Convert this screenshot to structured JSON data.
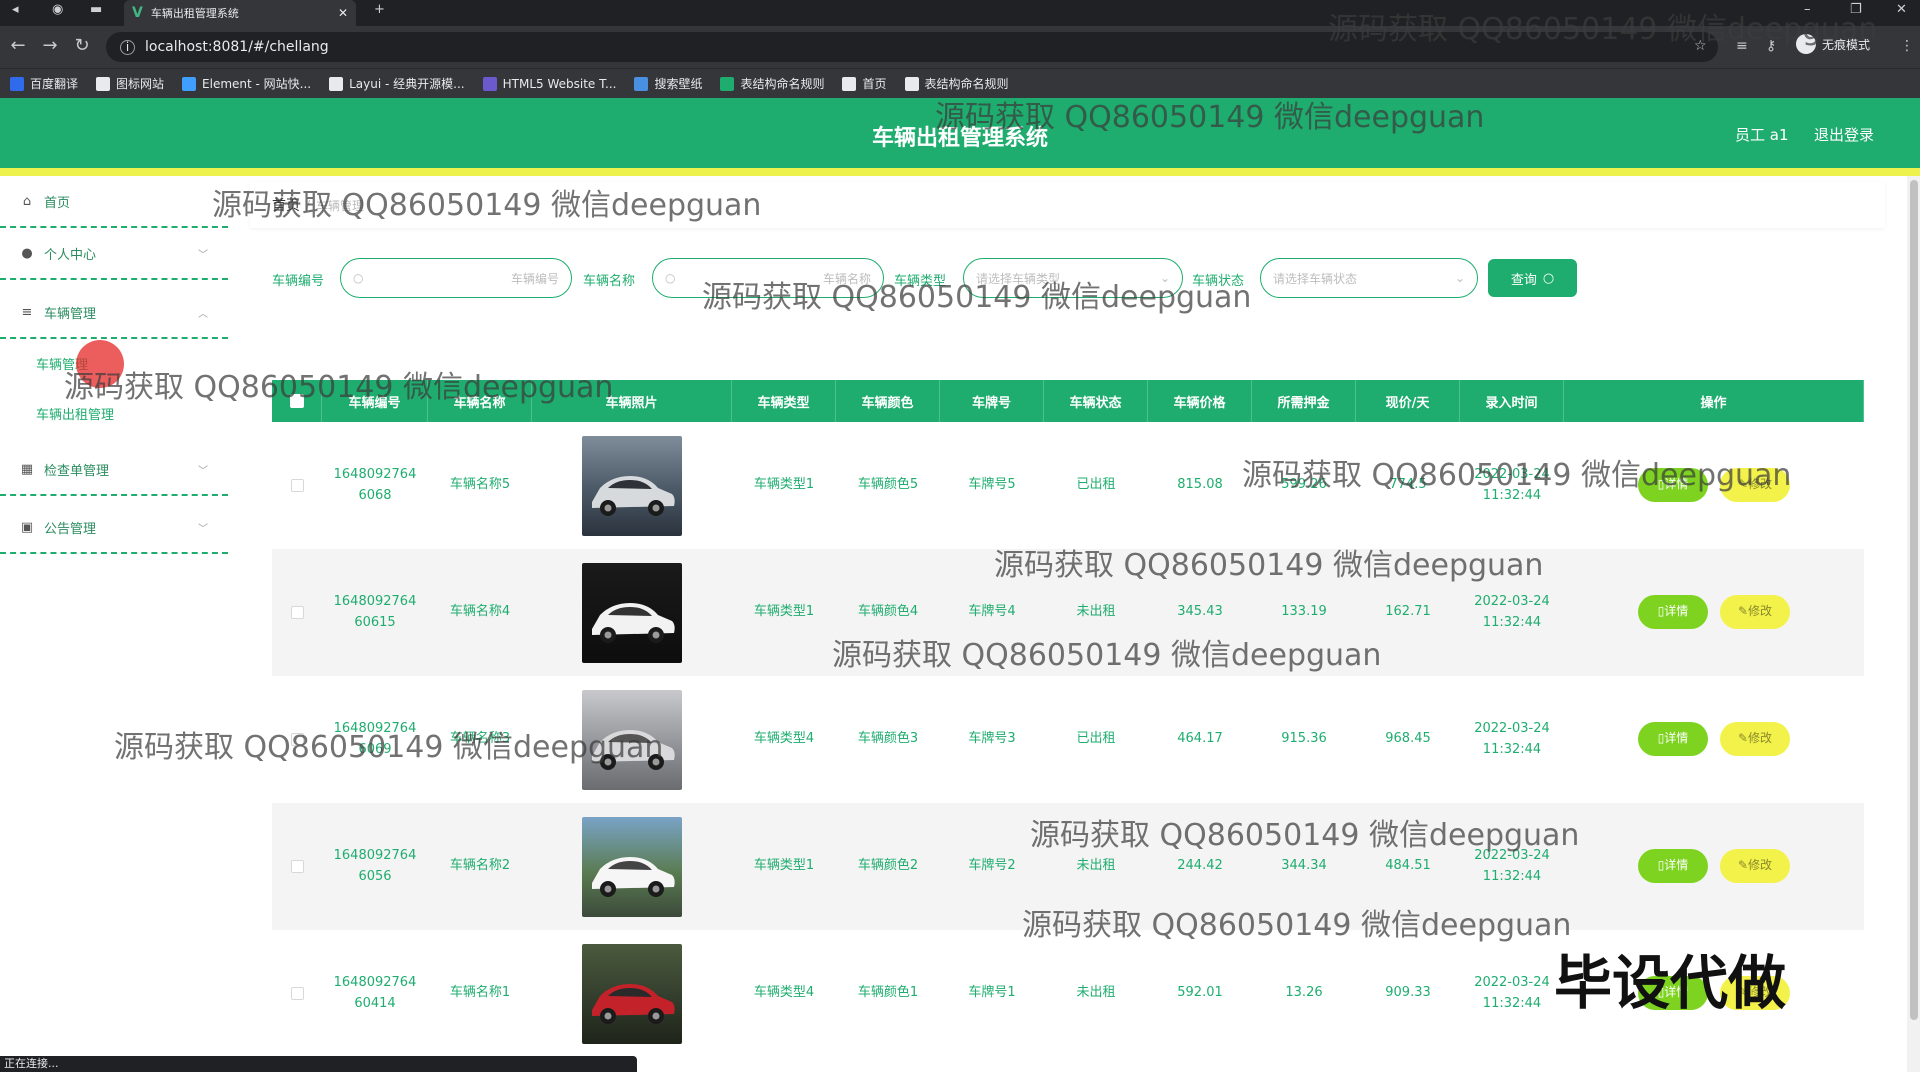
{
  "browser": {
    "tab_title": "车辆出租管理系统",
    "url": "localhost:8081/#/chellang",
    "profile_label": "无痕模式",
    "bookmarks": [
      {
        "label": "百度翻译",
        "color": "#2f6bea"
      },
      {
        "label": "图标网站",
        "color": "#e8eaed"
      },
      {
        "label": "Element - 网站快...",
        "color": "#409eff"
      },
      {
        "label": "Layui - 经典开源模...",
        "color": "#e8eaed"
      },
      {
        "label": "HTML5 Website T...",
        "color": "#6a5acd"
      },
      {
        "label": "搜索壁纸",
        "color": "#4a90e2"
      },
      {
        "label": "表结构命名规则",
        "color": "#1fad6f"
      },
      {
        "label": "首页",
        "color": "#e8eaed"
      },
      {
        "label": "表结构命名规则",
        "color": "#e8eaed"
      }
    ],
    "status_text": "正在连接..."
  },
  "header": {
    "title": "车辆出租管理系统",
    "user": "员工 a1",
    "logout": "退出登录"
  },
  "sidebar": {
    "items": [
      {
        "label": "首页",
        "icon": "home-icon",
        "glyph": "⌂"
      },
      {
        "label": "个人中心",
        "icon": "user-icon",
        "glyph": "●"
      },
      {
        "label": "车辆管理",
        "icon": "menu-icon",
        "glyph": "≡"
      },
      {
        "label": "检查单管理",
        "icon": "grid-icon",
        "glyph": "▦"
      },
      {
        "label": "公告管理",
        "icon": "notice-icon",
        "glyph": "▣"
      }
    ],
    "subitems": [
      "车辆管理",
      "车辆出租管理"
    ]
  },
  "breadcrumb": {
    "home": "首页",
    "current": "车辆管理"
  },
  "filters": {
    "code_label": "车辆编号",
    "code_placeholder": "车辆编号",
    "name_label": "车辆名称",
    "name_placeholder": "车辆名称",
    "type_label": "车辆类型",
    "type_placeholder": "请选择车辆类型",
    "status_label": "车辆状态",
    "status_placeholder": "请选择车辆状态",
    "search_label": "查询"
  },
  "table": {
    "headers": [
      "车辆编号",
      "车辆名称",
      "车辆照片",
      "车辆类型",
      "车辆颜色",
      "车牌号",
      "车辆状态",
      "车辆价格",
      "所需押金",
      "现价/天",
      "录入时间",
      "操作"
    ],
    "detail_label": "详情",
    "edit_label": "修改",
    "rows": [
      {
        "code1": "1648092764",
        "code2": "6068",
        "name": "车辆名称5",
        "type": "车辆类型1",
        "color": "车辆颜色5",
        "plate": "车牌号5",
        "status": "已出租",
        "price": "815.08",
        "deposit": "599.26",
        "daily": "774.5",
        "date": "2022-03-24",
        "time": "11:32:44",
        "photo": "dark-suv"
      },
      {
        "code1": "1648092764",
        "code2": "60615",
        "name": "车辆名称4",
        "type": "车辆类型1",
        "color": "车辆颜色4",
        "plate": "车牌号4",
        "status": "未出租",
        "price": "345.43",
        "deposit": "133.19",
        "daily": "162.71",
        "date": "2022-03-24",
        "time": "11:32:44",
        "photo": "white-hatchback"
      },
      {
        "code1": "1648092764",
        "code2": "6069",
        "name": "车辆名称3",
        "type": "车辆类型4",
        "color": "车辆颜色3",
        "plate": "车牌号3",
        "status": "已出租",
        "price": "464.17",
        "deposit": "915.36",
        "daily": "968.45",
        "date": "2022-03-24",
        "time": "11:32:44",
        "photo": "silver-sedan"
      },
      {
        "code1": "1648092764",
        "code2": "6056",
        "name": "车辆名称2",
        "type": "车辆类型1",
        "color": "车辆颜色2",
        "plate": "车牌号2",
        "status": "未出租",
        "price": "244.42",
        "deposit": "344.34",
        "daily": "484.51",
        "date": "2022-03-24",
        "time": "11:32:44",
        "photo": "white-sedan"
      },
      {
        "code1": "1648092764",
        "code2": "60414",
        "name": "车辆名称1",
        "type": "车辆类型4",
        "color": "车辆颜色1",
        "plate": "车牌号1",
        "status": "未出租",
        "price": "592.01",
        "deposit": "13.26",
        "daily": "909.33",
        "date": "2022-03-24",
        "time": "11:32:44",
        "photo": "red-suv"
      }
    ]
  },
  "overlays": {
    "watermark": "源码获取 QQ86050149 微信deepguan",
    "big_watermark": "毕设代做"
  },
  "colors": {
    "primary": "#1fad6f",
    "accent_yellow": "#eef24c",
    "detail_button": "#7ed321",
    "edit_button": "#f3f24b"
  }
}
